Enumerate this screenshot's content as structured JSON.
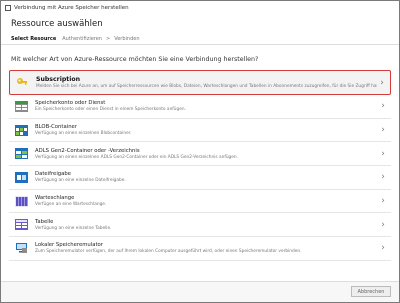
{
  "window": {
    "title": "Verbindung mit Azure Speicher herstellen"
  },
  "header": {
    "title": "Ressource auswählen"
  },
  "breadcrumb": {
    "active": "Select Resource",
    "step2": "Authentifizieren",
    "step3": "Verbinden",
    "separator": ">"
  },
  "question": "Mit welcher Art von Azure-Ressource möchten Sie eine Verbindung herstellen?",
  "items": [
    {
      "title": "Subscription",
      "desc": "Melden Sie sich bei Azure an, um auf Speicherressourcen wie Blobs, Dateien, Warteschlangen und Tabellen in Abonnements zuzugreifen, für die Sie Zugriff haben.",
      "icon": "key-icon"
    },
    {
      "title": "Speicherkonto oder Dienst",
      "desc": "Ein Speicherkonto oder einen Dienst in einem Speicherkonto anfügen.",
      "icon": "storage-account-icon"
    },
    {
      "title": "BLOB-Container",
      "desc": "Verfügung an einen einzelnen Blobcontainer.",
      "icon": "blob-container-icon"
    },
    {
      "title": "ADLS Gen2-Container oder -Verzeichnis",
      "desc": "Verfügung an einen einzelnen ADLS Gen2-Container oder ein ADLS Gen2-Verzeichnis anfügen.",
      "icon": "adls-container-icon"
    },
    {
      "title": "Dateifreigabe",
      "desc": "Verfügung an eine einzelne Dateifreigabe.",
      "icon": "file-share-icon"
    },
    {
      "title": "Warteschlange",
      "desc": "Verfügen an eine Warteschlange.",
      "icon": "queue-icon"
    },
    {
      "title": "Tabelle",
      "desc": "Verfügung an eine einzelne Tabelle.",
      "icon": "table-icon"
    },
    {
      "title": "Lokaler Speicheremulator",
      "desc": "Zum Speicheremulator verfügen, der auf Ihrem lokalen Computer ausgeführt wird, oder einen Speicheremulator verbinden.",
      "icon": "local-emulator-icon"
    }
  ],
  "footer": {
    "cancel_label": "Abbrechen"
  },
  "colors": {
    "selected_border": "#d63b3b",
    "accent_blue": "#1f6fbf",
    "key_gold": "#e8b923"
  }
}
